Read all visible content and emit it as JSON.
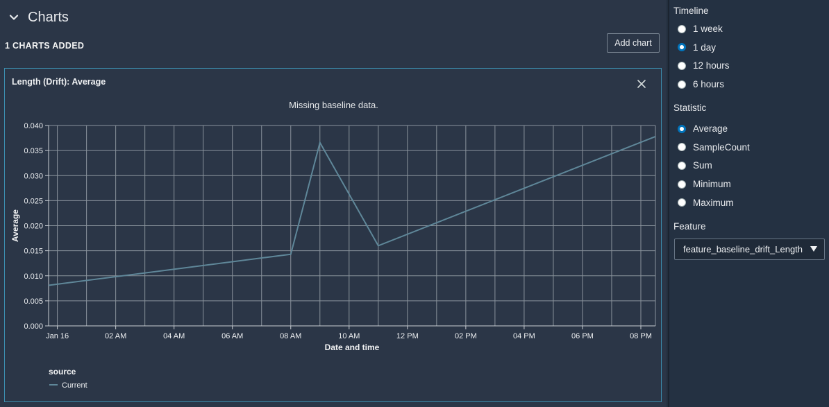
{
  "header": {
    "section_title": "Charts",
    "charts_count_label": "1 CHARTS ADDED",
    "add_chart_label": "Add chart"
  },
  "card": {
    "title": "Length (Drift): Average",
    "message": "Missing baseline data."
  },
  "sidebar": {
    "timeline_label": "Timeline",
    "timeline_options": [
      {
        "label": "1 week",
        "checked": false
      },
      {
        "label": "1 day",
        "checked": true
      },
      {
        "label": "12 hours",
        "checked": false
      },
      {
        "label": "6 hours",
        "checked": false
      }
    ],
    "statistic_label": "Statistic",
    "statistic_options": [
      {
        "label": "Average",
        "checked": true
      },
      {
        "label": "SampleCount",
        "checked": false
      },
      {
        "label": "Sum",
        "checked": false
      },
      {
        "label": "Minimum",
        "checked": false
      },
      {
        "label": "Maximum",
        "checked": false
      }
    ],
    "feature_label": "Feature",
    "feature_value": "feature_baseline_drift_Length"
  },
  "colors": {
    "accent": "#0073bb",
    "series_line": "#5f8799",
    "card_border": "#3c8fb0"
  },
  "chart_data": {
    "type": "line",
    "title": "",
    "xlabel": "Date and time",
    "ylabel": "Average",
    "x_ticks": [
      "Jan 16",
      "02 AM",
      "04 AM",
      "06 AM",
      "08 AM",
      "10 AM",
      "12 PM",
      "02 PM",
      "04 PM",
      "06 PM",
      "08 PM"
    ],
    "xlim_hours": [
      -0.3,
      20.5
    ],
    "ylim": [
      0,
      0.04
    ],
    "y_ticks": [
      "0.000",
      "0.005",
      "0.010",
      "0.015",
      "0.020",
      "0.025",
      "0.030",
      "0.035",
      "0.040"
    ],
    "grid": true,
    "legend": {
      "title": "source",
      "position": "bottom-left"
    },
    "series": [
      {
        "name": "Current",
        "x_hours": [
          -0.3,
          8.0,
          9.0,
          11.0,
          20.5
        ],
        "values": [
          0.0081,
          0.0143,
          0.0366,
          0.016,
          0.0378
        ]
      }
    ]
  }
}
